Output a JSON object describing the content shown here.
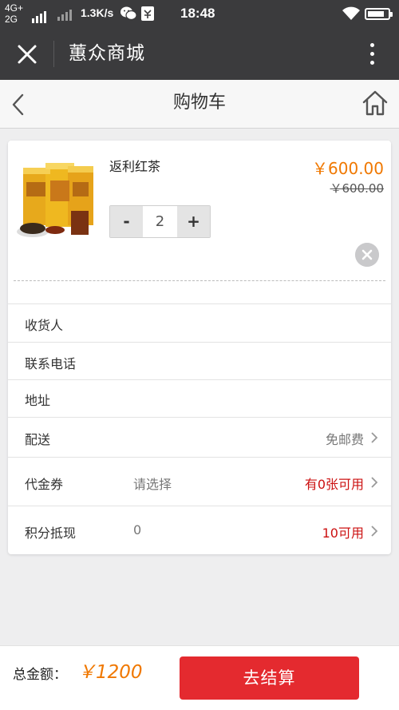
{
  "status_bar": {
    "network_top": "4G+",
    "network_bottom": "2G",
    "speed": "1.3K/s",
    "time": "18:48",
    "battery_level": 0.85,
    "icons": [
      "signal-icon",
      "wechat-icon",
      "notification-icon",
      "wifi-icon",
      "battery-icon"
    ]
  },
  "app_bar": {
    "title": "蕙众商城",
    "close_icon": "close-icon",
    "more_icon": "more-vertical-icon"
  },
  "page_header": {
    "title": "购物车",
    "back_icon": "chevron-left-icon",
    "home_icon": "home-icon"
  },
  "cart_item": {
    "name": "返利红茶",
    "price": "￥600.00",
    "original_price": "￥600.00",
    "quantity": "2",
    "minus_label": "-",
    "plus_label": "+",
    "image_icon": "product-tea-image",
    "remove_icon": "remove-icon"
  },
  "form": {
    "receiver_label": "收货人",
    "phone_label": "联系电话",
    "address_label": "地址",
    "delivery_label": "配送",
    "delivery_value": "免邮费",
    "coupon_label": "代金券",
    "coupon_placeholder": "请选择",
    "coupon_value": "有0张可用",
    "points_label": "积分抵现",
    "points_value": "0",
    "points_available": "10可用"
  },
  "footer": {
    "total_label": "总金额：",
    "total_value": "￥1200",
    "checkout_label": "去结算"
  },
  "colors": {
    "header_bg": "#3b3b3d",
    "price_orange": "#f07800",
    "alert_red": "#cc1111",
    "checkout_red": "#e42a2f",
    "background": "#eeeeef"
  }
}
